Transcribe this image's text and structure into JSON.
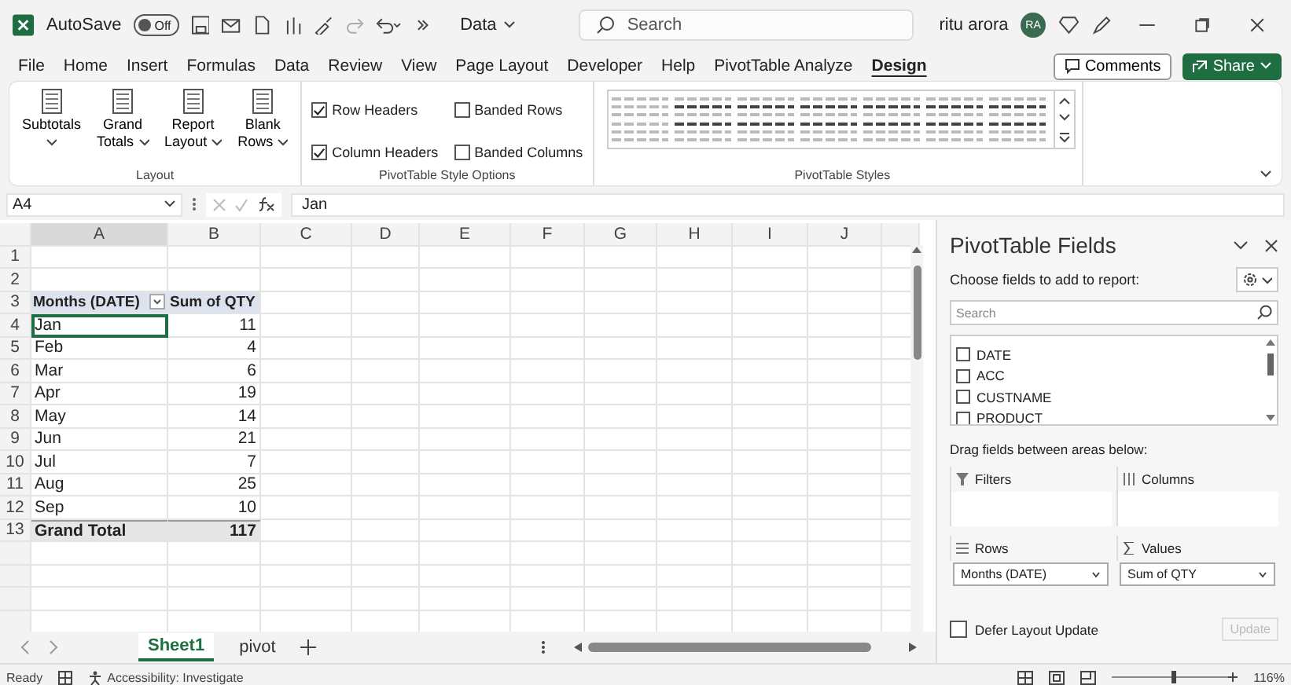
{
  "title_bar": {
    "autosave_label": "AutoSave",
    "autosave_toggle": {
      "label": "Off",
      "on": false
    },
    "file_name": "Data",
    "search": {
      "placeholder": "Search"
    },
    "user_name": "ritu arora",
    "avatar": "RA"
  },
  "menu_tabs": [
    {
      "label": "File",
      "selected": false
    },
    {
      "label": "Home",
      "selected": false
    },
    {
      "label": "Insert",
      "selected": false
    },
    {
      "label": "Formulas",
      "selected": false
    },
    {
      "label": "Data",
      "selected": false
    },
    {
      "label": "Review",
      "selected": false
    },
    {
      "label": "View",
      "selected": false
    },
    {
      "label": "Page Layout",
      "selected": false
    },
    {
      "label": "Developer",
      "selected": false
    },
    {
      "label": "Help",
      "selected": false
    },
    {
      "label": "PivotTable Analyze",
      "selected": false
    },
    {
      "label": "Design",
      "selected": true
    }
  ],
  "menu_buttons": {
    "comments": "Comments",
    "share": "Share"
  },
  "ribbon": {
    "layout_group": {
      "label": "Layout",
      "buttons": [
        {
          "line1": "Subtotals"
        },
        {
          "line1": "Grand",
          "line2": "Totals"
        },
        {
          "line1": "Report",
          "line2": "Layout"
        },
        {
          "line1": "Blank",
          "line2": "Rows"
        }
      ]
    },
    "style_options": {
      "label": "PivotTable Style Options",
      "checkboxes": [
        {
          "label": "Row Headers",
          "checked": true
        },
        {
          "label": "Banded Rows",
          "checked": false
        },
        {
          "label": "Column Headers",
          "checked": true
        },
        {
          "label": "Banded Columns",
          "checked": false
        }
      ]
    },
    "styles_group": {
      "label": "PivotTable Styles"
    }
  },
  "formula_bar": {
    "name_box": "A4",
    "formula": "Jan"
  },
  "sheet": {
    "columns": [
      "A",
      "B",
      "C",
      "D",
      "E",
      "F",
      "G",
      "H",
      "I",
      "J"
    ],
    "row_numbers": [
      "1",
      "2",
      "3",
      "4",
      "5",
      "6",
      "7",
      "8",
      "9",
      "10",
      "11",
      "12",
      "13"
    ],
    "pivot": {
      "header": [
        "Months (DATE)",
        "Sum of QTY"
      ],
      "rows": [
        {
          "label": "Jan",
          "value": "11",
          "selected": true
        },
        {
          "label": "Feb",
          "value": "4",
          "selected": false
        },
        {
          "label": "Mar",
          "value": "6",
          "selected": false
        },
        {
          "label": "Apr",
          "value": "19",
          "selected": false
        },
        {
          "label": "May",
          "value": "14",
          "selected": false
        },
        {
          "label": "Jun",
          "value": "21",
          "selected": false
        },
        {
          "label": "Jul",
          "value": "7",
          "selected": false
        },
        {
          "label": "Aug",
          "value": "25",
          "selected": false
        },
        {
          "label": "Sep",
          "value": "10",
          "selected": false
        }
      ],
      "total": {
        "label": "Grand Total",
        "value": "117"
      }
    }
  },
  "sheet_tabs": [
    {
      "label": "Sheet1",
      "selected": true
    },
    {
      "label": "pivot",
      "selected": false
    }
  ],
  "pivot_pane": {
    "title": "PivotTable Fields",
    "subtitle": "Choose fields to add to report:",
    "search": {
      "placeholder": "Search"
    },
    "fields": [
      {
        "label": "DATE",
        "checked": false
      },
      {
        "label": "ACC",
        "checked": false
      },
      {
        "label": "CUSTNAME",
        "checked": false
      },
      {
        "label": "PRODUCT",
        "checked": false
      }
    ],
    "areas_hint": "Drag fields between areas below:",
    "areas": [
      {
        "kind": "filters",
        "label": "Filters"
      },
      {
        "kind": "columns",
        "label": "Columns"
      },
      {
        "kind": "rows",
        "label": "Rows",
        "items": [
          "Months (DATE)"
        ]
      },
      {
        "kind": "values",
        "label": "Values",
        "items": [
          "Sum of QTY"
        ]
      }
    ],
    "defer": {
      "label": "Defer Layout Update",
      "checked": false
    },
    "update_button": {
      "label": "Update",
      "disabled": true
    }
  },
  "status_bar": {
    "status": "Ready",
    "accessibility": "Accessibility: Investigate",
    "zoom": "116%"
  }
}
